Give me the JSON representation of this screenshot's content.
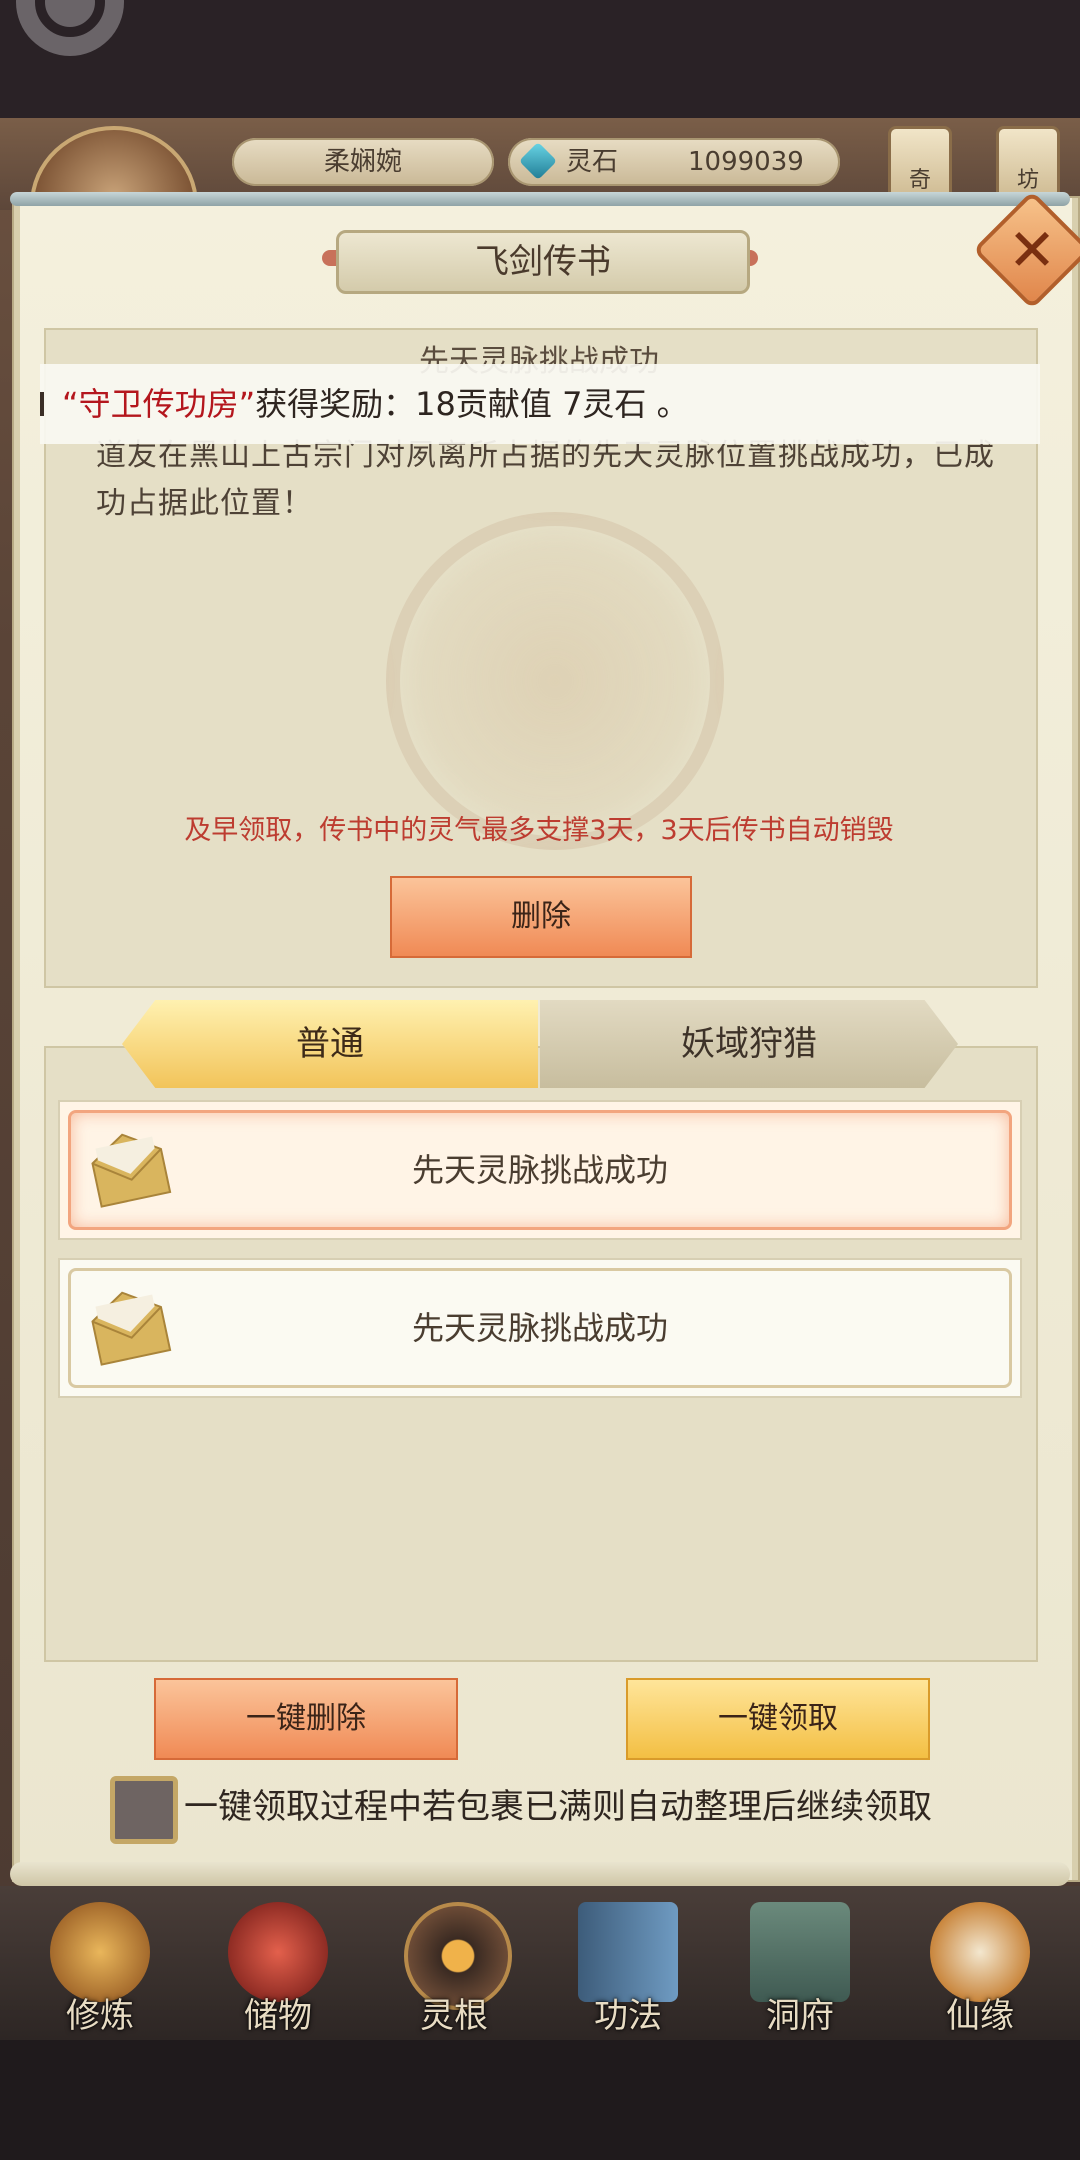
{
  "hud": {
    "player_name": "柔娴婉",
    "resource_label": "灵石",
    "resource_value": "1099039",
    "side_tab_1": "奇",
    "side_tab_2": "坊"
  },
  "dialog": {
    "title": "飞剑传书",
    "close_icon": "✕"
  },
  "mail": {
    "title": "先天灵脉挑战成功",
    "body": "道友在黑山上古宗门对夙离所占据的先天灵脉位置挑战成功，已成功占据此位置！",
    "expire_note": "及早领取，传书中的灵气最多支撑3天，3天后传书自动销毁",
    "delete_label": "删除"
  },
  "toast": {
    "highlight": "“守卫传功房”",
    "text": "获得奖励：18贡献值 7灵石 。"
  },
  "tabs": [
    {
      "label": "普通",
      "active": true
    },
    {
      "label": "妖域狩猎",
      "active": false
    }
  ],
  "mail_list": [
    {
      "label": "先天灵脉挑战成功",
      "selected": true,
      "icon": "envelope-icon"
    },
    {
      "label": "先天灵脉挑战成功",
      "selected": false,
      "icon": "envelope-icon"
    }
  ],
  "actions": {
    "delete_all": "一键删除",
    "claim_all": "一键领取",
    "auto_sort_label": "一键领取过程中若包裹已满则自动整理后继续领取",
    "auto_sort_checked": false
  },
  "bottom_nav": [
    {
      "label": "修炼",
      "icon": "cultivate-icon"
    },
    {
      "label": "储物",
      "icon": "storage-bag-icon"
    },
    {
      "label": "灵根",
      "icon": "spirit-root-icon"
    },
    {
      "label": "功法",
      "icon": "technique-book-icon"
    },
    {
      "label": "洞府",
      "icon": "cave-dwelling-icon"
    },
    {
      "label": "仙缘",
      "icon": "immortal-fate-icon"
    }
  ],
  "colors": {
    "accent_orange": "#f08a55",
    "accent_gold": "#f3bf43",
    "warning_red": "#bd3c30",
    "toast_highlight": "#b4161d"
  }
}
